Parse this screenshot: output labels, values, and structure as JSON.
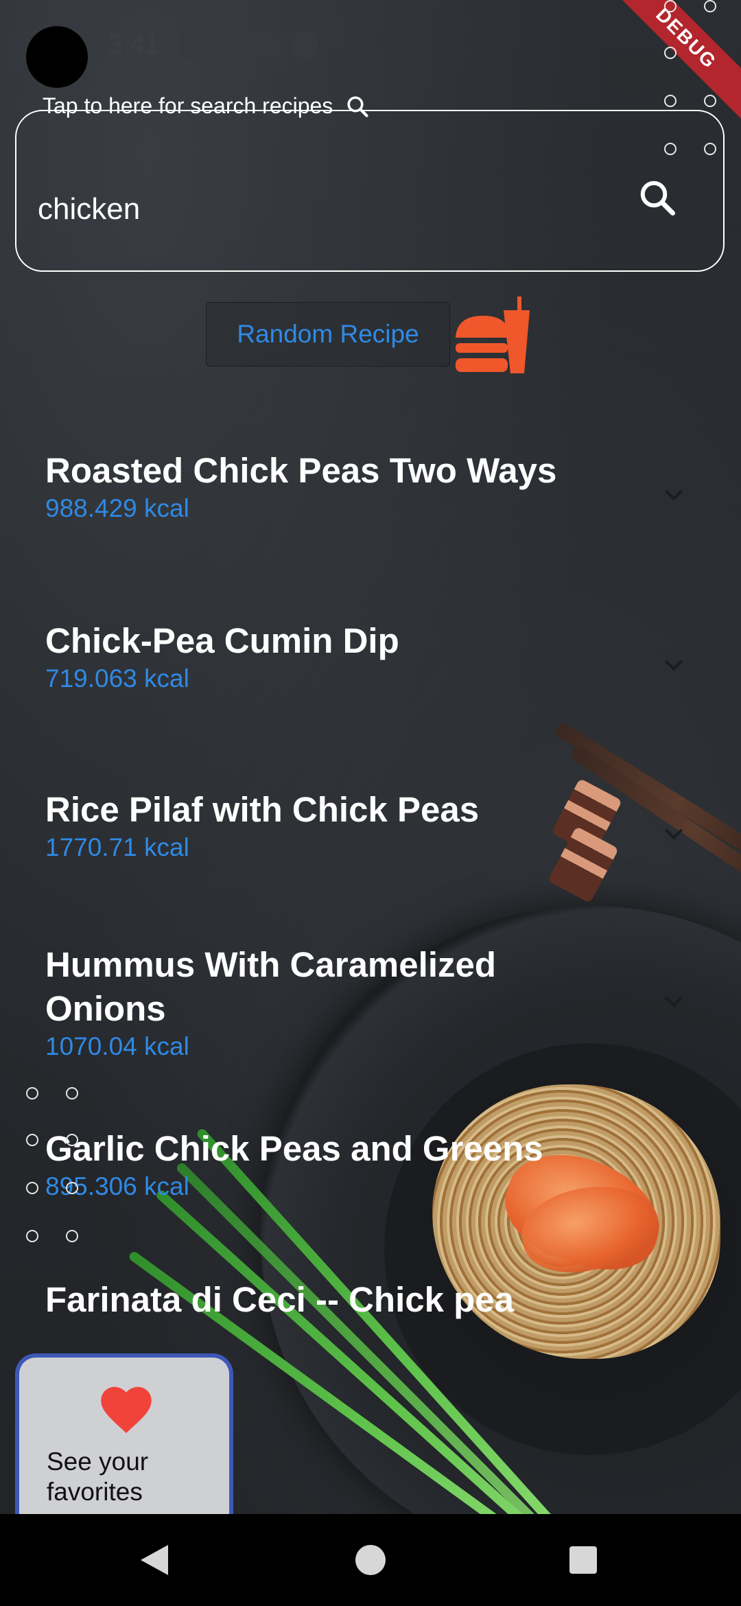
{
  "status_bar": {
    "time": "3:41",
    "debug_banner": "DEBUG"
  },
  "search": {
    "hint": "Tap to here for search  recipes",
    "value": "chicken"
  },
  "random_recipe": {
    "label": "Random Recipe"
  },
  "recipes": [
    {
      "title": "Roasted Chick Peas Two Ways",
      "kcal": "988.429 kcal"
    },
    {
      "title": "Chick-Pea Cumin Dip",
      "kcal": "719.063 kcal"
    },
    {
      "title": "Rice Pilaf with Chick Peas",
      "kcal": "1770.71 kcal"
    },
    {
      "title": "Hummus With Caramelized Onions",
      "kcal": "1070.04 kcal"
    },
    {
      "title": "Garlic Chick Peas and Greens",
      "kcal": "895.306 kcal"
    },
    {
      "title": "Farinata di Ceci -- Chick pea",
      "kcal": ""
    }
  ],
  "favorites": {
    "label": "See your favorites"
  },
  "colors": {
    "accent_blue": "#2f8ae5",
    "burger_orange": "#f0572a",
    "heart_red": "#f0443a",
    "card_border": "#3f57b8"
  }
}
